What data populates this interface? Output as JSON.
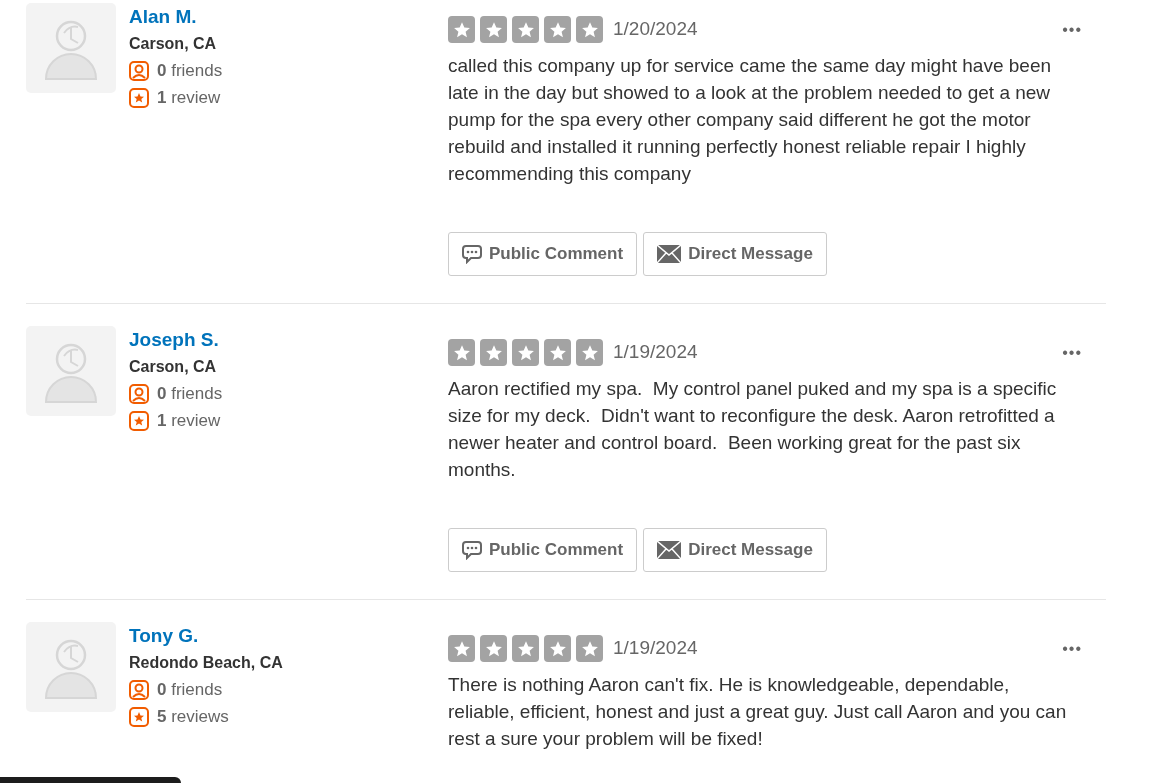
{
  "reviews": [
    {
      "name": "Alan M.",
      "location": "Carson, CA",
      "friends_count": "0",
      "friends_label": "friends",
      "reviews_count": "1",
      "reviews_label": "review",
      "stars": 0,
      "date": "1/20/2024",
      "text": "called this company up for service came the same day might have been late in the day but showed to a look at the problem needed to get a new pump for the spa every other company said different he got the motor rebuild and installed it running perfectly honest reliable repair I highly recommending this company",
      "more": "•••",
      "buttons": [
        {
          "kind": "comment",
          "label": "Public Comment"
        },
        {
          "kind": "message",
          "label": "Direct Message"
        }
      ]
    },
    {
      "name": "Joseph S.",
      "location": "Carson, CA",
      "friends_count": "0",
      "friends_label": "friends",
      "reviews_count": "1",
      "reviews_label": "review",
      "stars": 0,
      "date": "1/19/2024",
      "text": "Aaron rectified my spa.  My control panel puked and my spa is a specific size for my deck.  Didn't want to reconfigure the desk. Aaron retrofitted a newer heater and control board.  Been working great for the past six months.",
      "more": "•••",
      "buttons": [
        {
          "kind": "comment",
          "label": "Public Comment"
        },
        {
          "kind": "message",
          "label": "Direct Message"
        }
      ]
    },
    {
      "name": "Tony G.",
      "location": "Redondo Beach, CA",
      "friends_count": "0",
      "friends_label": "friends",
      "reviews_count": "5",
      "reviews_label": "reviews",
      "stars": 0,
      "date": "1/19/2024",
      "text": "There is nothing Aaron can't fix. He is knowledgeable, dependable, reliable, efficient, honest and just a great guy. Just call Aaron and you can rest a sure your problem will be fixed!",
      "more": "•••"
    }
  ]
}
